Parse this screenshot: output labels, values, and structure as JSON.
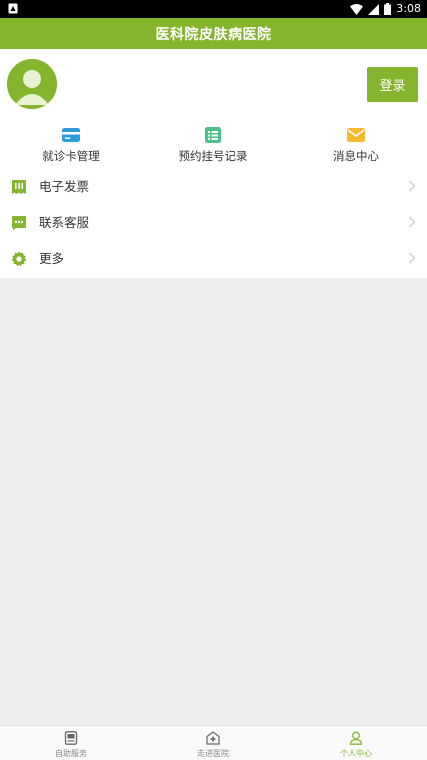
{
  "status_bar": {
    "time": "3:08"
  },
  "header": {
    "title": "医科院皮肤病医院"
  },
  "profile": {
    "login_label": "登录"
  },
  "quick_actions": [
    {
      "label": "就诊卡管理",
      "icon": "card-icon",
      "color": "#2d9cdb"
    },
    {
      "label": "预约挂号记录",
      "icon": "list-icon",
      "color": "#4cc28a"
    },
    {
      "label": "消息中心",
      "icon": "envelope-icon",
      "color": "#f5b92f"
    }
  ],
  "menu": [
    {
      "label": "电子发票",
      "icon": "invoice-icon"
    },
    {
      "label": "联系客服",
      "icon": "chat-icon"
    },
    {
      "label": "更多",
      "icon": "gear-icon"
    }
  ],
  "bottom_nav": [
    {
      "label": "自助服务",
      "icon": "self-service-icon"
    },
    {
      "label": "走进医院",
      "icon": "hospital-icon"
    },
    {
      "label": "个人中心",
      "icon": "person-icon",
      "active": true
    }
  ],
  "colors": {
    "brand": "#85b52e",
    "background": "#eeeeee"
  }
}
